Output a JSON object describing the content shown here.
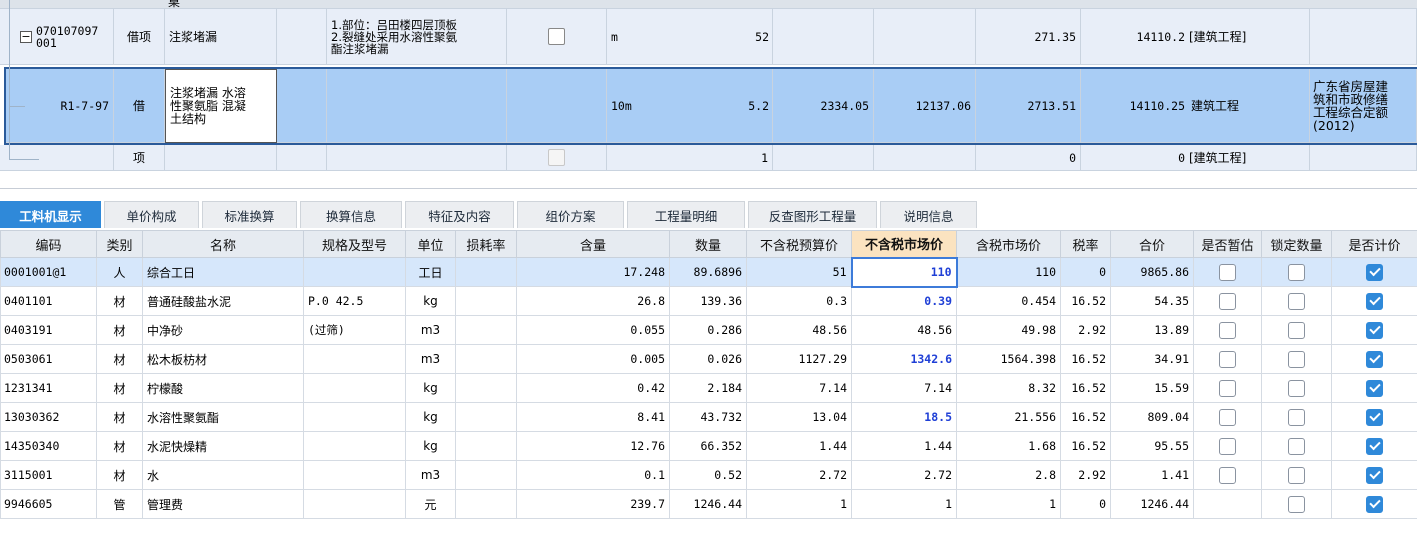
{
  "top_grid": {
    "header_partial": "桌",
    "item_row": {
      "code_line1": "070107097",
      "code_line2": "001",
      "type": "借项",
      "name": "注浆堵漏",
      "feature": "1.部位：吕田楼四层顶板\n2.裂缝处采用水溶性聚氨\n酯注浆堵漏",
      "unit": "m",
      "quantity": "52",
      "price": "271.35",
      "total": "14110.2",
      "category": "[建筑工程]",
      "tree_toggle": "−"
    },
    "quota_row": {
      "code": "R1-7-97",
      "type": "借",
      "name": "注浆堵漏 水溶\n性聚氨脂 混凝\n土结构",
      "unit": "10m",
      "quantity": "5.2",
      "base_price": "2334.05",
      "base_total": "12137.06",
      "price": "2713.51",
      "total": "14110.25",
      "category": "建筑工程",
      "quota_book": "广东省房屋建\n筑和市政修缮\n工程综合定额\n(2012)"
    },
    "empty_row": {
      "type": "项",
      "quantity": "1",
      "price": "0",
      "total": "0",
      "category": "[建筑工程]"
    }
  },
  "tabs": [
    {
      "label": "工料机显示",
      "active": true
    },
    {
      "label": "单价构成",
      "active": false
    },
    {
      "label": "标准换算",
      "active": false
    },
    {
      "label": "换算信息",
      "active": false
    },
    {
      "label": "特征及内容",
      "active": false
    },
    {
      "label": "组价方案",
      "active": false
    },
    {
      "label": "工程量明细",
      "active": false
    },
    {
      "label": "反查图形工程量",
      "active": false
    },
    {
      "label": "说明信息",
      "active": false
    }
  ],
  "grid": {
    "columns": [
      "编码",
      "类别",
      "名称",
      "规格及型号",
      "单位",
      "损耗率",
      "含量",
      "数量",
      "不含税预算价",
      "不含税市场价",
      "含税市场价",
      "税率",
      "合价",
      "是否暂估",
      "锁定数量",
      "是否计价"
    ],
    "rows": [
      {
        "code": "0001001@1",
        "cat": "人",
        "name": "综合工日",
        "spec": "",
        "unit": "工日",
        "loss": "",
        "content": "17.248",
        "qty": "89.6896",
        "budget": "51",
        "market": "110",
        "market_tax": "110",
        "tax": "0",
        "total": "9865.86",
        "est": false,
        "lock": false,
        "priced": true,
        "market_blue": true,
        "selected": true
      },
      {
        "code": "0401101",
        "cat": "材",
        "name": "普通硅酸盐水泥",
        "spec": "P.0 42.5",
        "unit": "kg",
        "loss": "",
        "content": "26.8",
        "qty": "139.36",
        "budget": "0.3",
        "market": "0.39",
        "market_tax": "0.454",
        "tax": "16.52",
        "total": "54.35",
        "est": false,
        "lock": false,
        "priced": true,
        "market_blue": true,
        "selected": false
      },
      {
        "code": "0403191",
        "cat": "材",
        "name": "中净砂",
        "spec": "(过筛)",
        "unit": "m3",
        "loss": "",
        "content": "0.055",
        "qty": "0.286",
        "budget": "48.56",
        "market": "48.56",
        "market_tax": "49.98",
        "tax": "2.92",
        "total": "13.89",
        "est": false,
        "lock": false,
        "priced": true,
        "market_blue": false,
        "selected": false
      },
      {
        "code": "0503061",
        "cat": "材",
        "name": "松木板枋材",
        "spec": "",
        "unit": "m3",
        "loss": "",
        "content": "0.005",
        "qty": "0.026",
        "budget": "1127.29",
        "market": "1342.6",
        "market_tax": "1564.398",
        "tax": "16.52",
        "total": "34.91",
        "est": false,
        "lock": false,
        "priced": true,
        "market_blue": true,
        "selected": false
      },
      {
        "code": "1231341",
        "cat": "材",
        "name": "柠檬酸",
        "spec": "",
        "unit": "kg",
        "loss": "",
        "content": "0.42",
        "qty": "2.184",
        "budget": "7.14",
        "market": "7.14",
        "market_tax": "8.32",
        "tax": "16.52",
        "total": "15.59",
        "est": false,
        "lock": false,
        "priced": true,
        "market_blue": false,
        "selected": false
      },
      {
        "code": "13030362",
        "cat": "材",
        "name": "水溶性聚氨酯",
        "spec": "",
        "unit": "kg",
        "loss": "",
        "content": "8.41",
        "qty": "43.732",
        "budget": "13.04",
        "market": "18.5",
        "market_tax": "21.556",
        "tax": "16.52",
        "total": "809.04",
        "est": false,
        "lock": false,
        "priced": true,
        "market_blue": true,
        "selected": false
      },
      {
        "code": "14350340",
        "cat": "材",
        "name": "水泥快燥精",
        "spec": "",
        "unit": "kg",
        "loss": "",
        "content": "12.76",
        "qty": "66.352",
        "budget": "1.44",
        "market": "1.44",
        "market_tax": "1.68",
        "tax": "16.52",
        "total": "95.55",
        "est": false,
        "lock": false,
        "priced": true,
        "market_blue": false,
        "selected": false
      },
      {
        "code": "3115001",
        "cat": "材",
        "name": "水",
        "spec": "",
        "unit": "m3",
        "loss": "",
        "content": "0.1",
        "qty": "0.52",
        "budget": "2.72",
        "market": "2.72",
        "market_tax": "2.8",
        "tax": "2.92",
        "total": "1.41",
        "est": false,
        "lock": false,
        "priced": true,
        "market_blue": false,
        "selected": false
      },
      {
        "code": "9946605",
        "cat": "管",
        "name": "管理费",
        "spec": "",
        "unit": "元",
        "loss": "",
        "content": "239.7",
        "qty": "1246.44",
        "budget": "1",
        "market": "1",
        "market_tax": "1",
        "tax": "0",
        "total": "1246.44",
        "est": null,
        "lock": false,
        "priced": true,
        "market_blue": false,
        "selected": false
      }
    ]
  },
  "colors": {
    "tab_active": "#2f89d9",
    "quota_row_bg": "#a9cdf5",
    "item_row_bg": "#e8eef8",
    "highlight_header": "#fbe3c0",
    "blue_value": "#1f3fd6"
  }
}
